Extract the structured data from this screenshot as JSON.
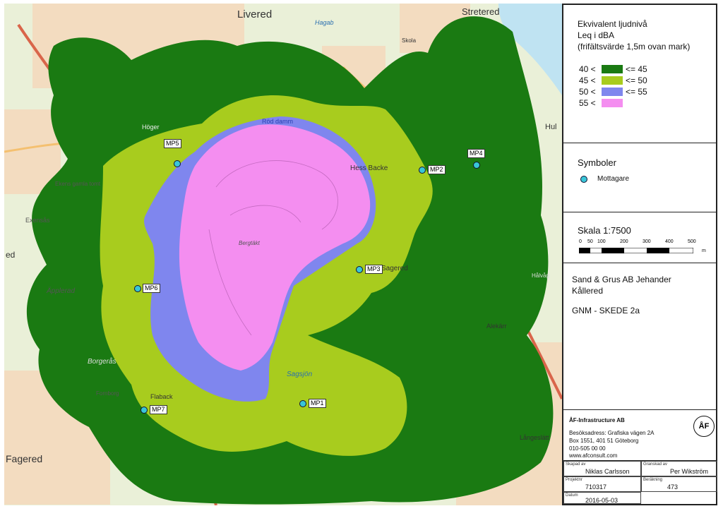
{
  "map": {
    "places": {
      "livered": "Livered",
      "stretered": "Stretered",
      "hagab": "Hagab",
      "skola": "Skola",
      "hoger": "Höger",
      "hul": "Hul",
      "ekens": "Ekens gamla tomt",
      "exensas": "Exensås",
      "applerad": "Äpplerad",
      "bergtakt": "Bergtäkt",
      "sagered": "Sagered",
      "hassbacke": "Hess Backe",
      "halvag": "Hålvåg",
      "alekarr": "Alekärr",
      "borgeras": "Borgerås",
      "flaback": "Flaback",
      "fornborg": "Fornborg",
      "sagsjon": "Sagsjön",
      "langeslatt": "Långeslätt",
      "fagered": "Fagered",
      "rodadammen": "Röd damm",
      "ed": "ed"
    },
    "receivers": [
      {
        "id": "MP1"
      },
      {
        "id": "MP2"
      },
      {
        "id": "MP3"
      },
      {
        "id": "MP4"
      },
      {
        "id": "MP5"
      },
      {
        "id": "MP6"
      },
      {
        "id": "MP7"
      }
    ]
  },
  "legend": {
    "title1": "Ekvivalent ljudnivå",
    "title2": "Leq i dBA",
    "title3": "(frifältsvärde 1,5m ovan mark)",
    "classes": [
      {
        "from": "40 <",
        "to": "<= 45",
        "color": "#1a7a12"
      },
      {
        "from": "45 <",
        "to": "<= 50",
        "color": "#a8cc1e"
      },
      {
        "from": "50 <",
        "to": "<= 55",
        "color": "#7f86ee"
      },
      {
        "from": "55 <",
        "to": "",
        "color": "#f48ef0"
      }
    ]
  },
  "symbols": {
    "title": "Symboler",
    "receiver": "Mottagare"
  },
  "scale": {
    "title": "Skala 1:7500",
    "ticks": [
      "0",
      "50",
      "100",
      "200",
      "300",
      "400",
      "500"
    ],
    "unit": "m"
  },
  "project": {
    "client": "Sand & Grus AB Jehander",
    "site": "Kållered",
    "stage": "GNM - SKEDE 2a"
  },
  "company": {
    "name": "ÅF-Infrastructure AB",
    "address": "Besöksadress: Grafiska vägen 2A",
    "box": "Box 1551, 401 51  Göteborg",
    "phone": "010-505 00 00",
    "web": "www.afconsult.com",
    "logo": "ÅF"
  },
  "titleblock": {
    "created_cap": "Skapad av",
    "created": "Niklas Carlsson",
    "checked_cap": "Granskad av",
    "checked": "Per Wikström",
    "project_cap": "Projektnr",
    "project": "710317",
    "calc_cap": "Beräkning",
    "calc": "473",
    "date_cap": "Datum",
    "date": "2016-05-03"
  }
}
